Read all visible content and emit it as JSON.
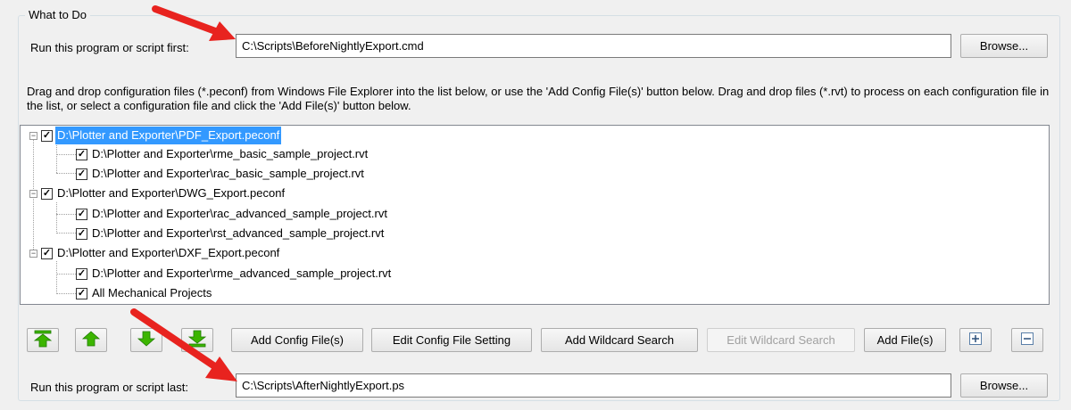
{
  "group_title": "What to Do",
  "run_first": {
    "label": "Run this program or script first:",
    "value": "C:\\Scripts\\BeforeNightlyExport.cmd",
    "browse_label": "Browse..."
  },
  "instructions": "Drag and drop configuration files (*.peconf) from Windows File Explorer into the list below, or use the 'Add Config File(s)' button below.  Drag and drop files (*.rvt) to process on each configuration file in the list, or select a configuration file and click the 'Add File(s)' button below.",
  "tree": {
    "items": [
      {
        "label": "D:\\Plotter and Exporter\\PDF_Export.peconf",
        "checked": true,
        "selected": true
      },
      {
        "label": "D:\\Plotter and Exporter\\rme_basic_sample_project.rvt",
        "checked": true
      },
      {
        "label": "D:\\Plotter and Exporter\\rac_basic_sample_project.rvt",
        "checked": true
      },
      {
        "label": "D:\\Plotter and Exporter\\DWG_Export.peconf",
        "checked": true
      },
      {
        "label": "D:\\Plotter and Exporter\\rac_advanced_sample_project.rvt",
        "checked": true
      },
      {
        "label": "D:\\Plotter and Exporter\\rst_advanced_sample_project.rvt",
        "checked": true
      },
      {
        "label": "D:\\Plotter and Exporter\\DXF_Export.peconf",
        "checked": true
      },
      {
        "label": "D:\\Plotter and Exporter\\rme_advanced_sample_project.rvt",
        "checked": true
      },
      {
        "label": "All Mechanical Projects",
        "checked": true
      }
    ]
  },
  "toolbar": {
    "move_top_icon": "move-to-top-icon",
    "move_up_icon": "move-up-icon",
    "move_down_icon": "move-down-icon",
    "move_bottom_icon": "move-to-bottom-icon",
    "add_config": "Add Config File(s)",
    "edit_config": "Edit  Config  File  Setting",
    "add_wildcard": "Add Wildcard Search",
    "edit_wildcard": "Edit Wildcard Search",
    "add_files": "Add File(s)",
    "expand_all_icon": "expand-all-icon",
    "collapse_all_icon": "collapse-all-icon"
  },
  "run_last": {
    "label": "Run this program or script last:",
    "value": "C:\\Scripts\\AfterNightlyExport.ps",
    "browse_label": "Browse..."
  },
  "colors": {
    "arrow_green": "#3cb500",
    "annotation_red": "#e8231f",
    "selection": "#3399ff"
  }
}
